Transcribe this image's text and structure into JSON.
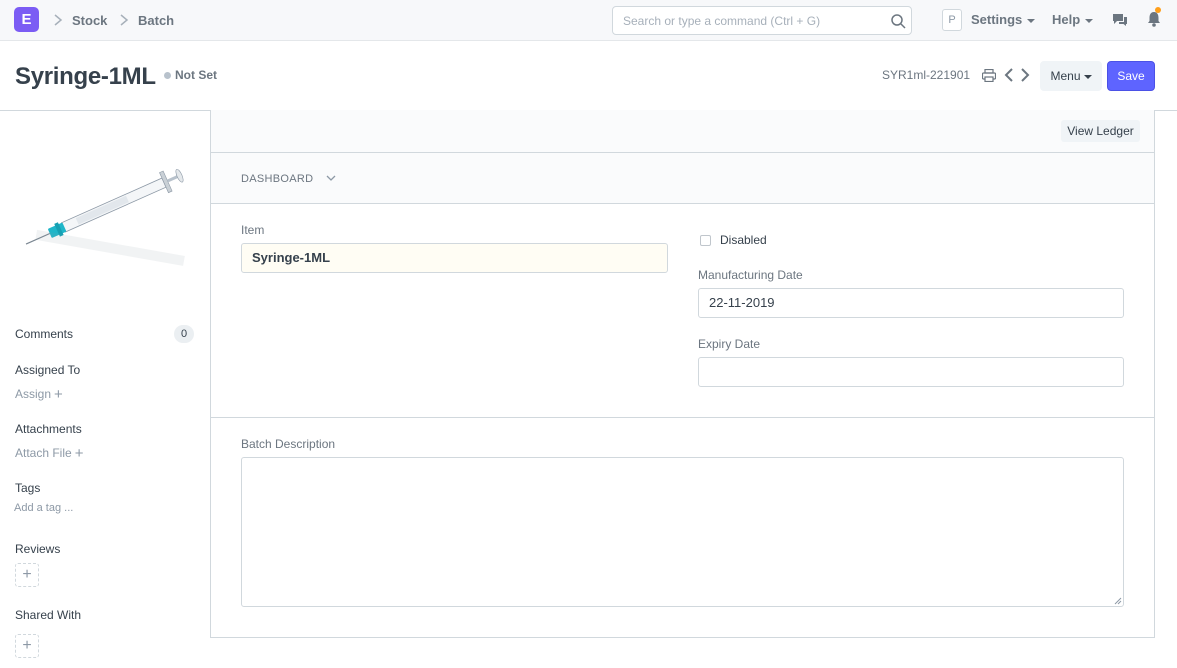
{
  "navbar": {
    "logo_letter": "E",
    "breadcrumbs": [
      "Stock",
      "Batch"
    ],
    "search_placeholder": "Search or type a command (Ctrl + G)",
    "avatar_letter": "P",
    "settings_label": "Settings",
    "help_label": "Help",
    "icons": [
      "search-icon",
      "chat-icon",
      "bell-icon"
    ]
  },
  "page_head": {
    "title": "Syringe-1ML",
    "status": "Not Set",
    "doc_name": "SYR1ml-221901",
    "menu_label": "Menu",
    "save_label": "Save",
    "primary_color": "#5e64ff"
  },
  "sidebar": {
    "comments_label": "Comments",
    "comments_count": "0",
    "assigned_label": "Assigned To",
    "assign_link": "Assign",
    "attachments_label": "Attachments",
    "attach_link": "Attach File",
    "tags_label": "Tags",
    "tags_link": "Add a tag ...",
    "reviews_label": "Reviews",
    "shared_label": "Shared With"
  },
  "form": {
    "view_ledger_label": "View Ledger",
    "dashboard_label": "DASHBOARD",
    "item_label": "Item",
    "item_value": "Syringe-1ML",
    "disabled_label": "Disabled",
    "disabled_checked": false,
    "mfg_label": "Manufacturing Date",
    "mfg_value": "22-11-2019",
    "expiry_label": "Expiry Date",
    "expiry_value": "",
    "description_label": "Batch Description",
    "description_value": ""
  }
}
